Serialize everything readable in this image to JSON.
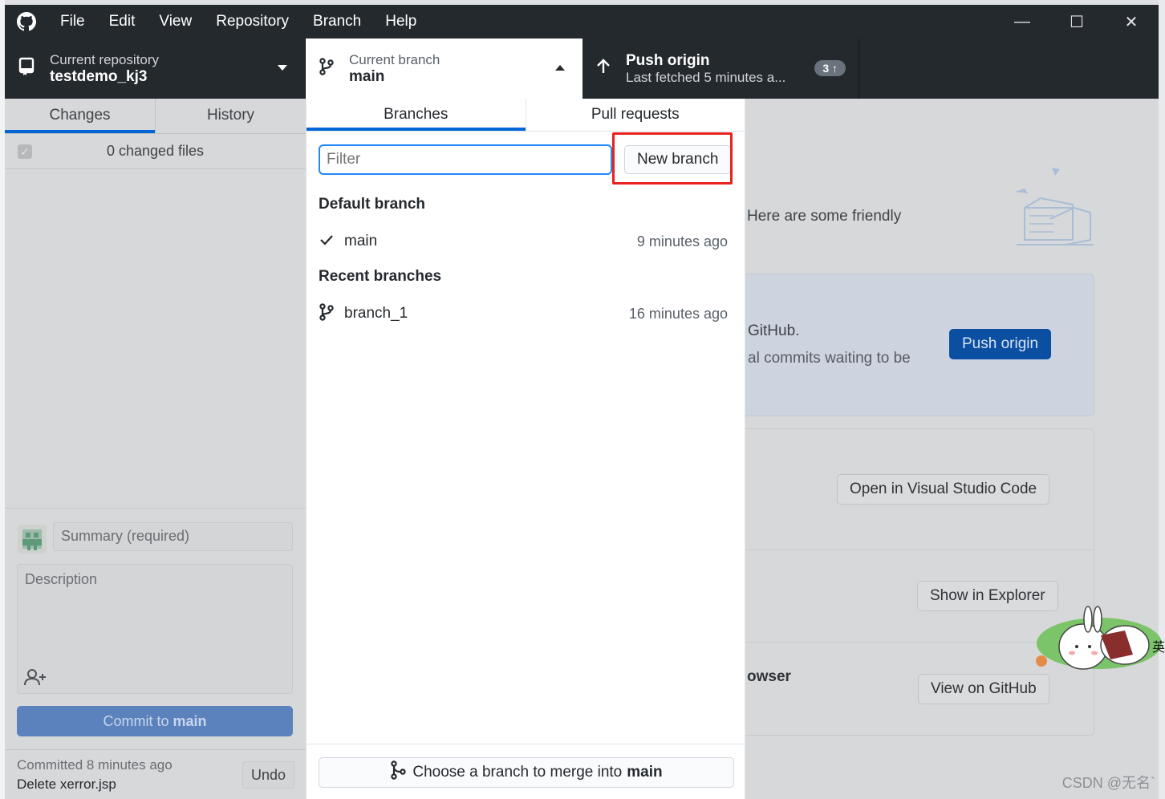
{
  "menu": {
    "items": [
      "File",
      "Edit",
      "View",
      "Repository",
      "Branch",
      "Help"
    ]
  },
  "window_controls": {
    "minimize": "—",
    "maximize": "☐",
    "close": "✕"
  },
  "toolbar": {
    "repo_sub": "Current repository",
    "repo_name": "testdemo_kj3",
    "branch_sub": "Current branch",
    "branch_name": "main",
    "push_title": "Push origin",
    "push_sub": "Last fetched 5 minutes a...",
    "push_badge": "3 ↑"
  },
  "sidebar": {
    "tab_changes": "Changes",
    "tab_history": "History",
    "changed_files": "0 changed files",
    "summary_placeholder": "Summary (required)",
    "description_placeholder": "Description",
    "commit_label": "Commit to",
    "commit_branch": "main",
    "last_commit_time": "Committed 8 minutes ago",
    "last_commit_msg": "Delete xerror.jsp",
    "undo_label": "Undo"
  },
  "dropdown": {
    "tab_branches": "Branches",
    "tab_pull_requests": "Pull requests",
    "filter_placeholder": "Filter",
    "new_branch_label": "New branch",
    "default_heading": "Default branch",
    "default_branches": [
      {
        "name": "main",
        "time": "9 minutes ago"
      }
    ],
    "recent_heading": "Recent branches",
    "recent_branches": [
      {
        "name": "branch_1",
        "time": "16 minutes ago"
      }
    ],
    "merge_label": "Choose a branch to merge into",
    "merge_target": "main"
  },
  "main": {
    "friendly_text": "Here are some friendly",
    "push_card_line1": "GitHub.",
    "push_card_line2": "al commits waiting to be",
    "push_origin_button": "Push origin",
    "open_vscode": "Open in Visual Studio Code",
    "show_explorer": "Show in Explorer",
    "browser_text": "owser",
    "view_github": "View on GitHub"
  },
  "watermark": "CSDN @无名`",
  "colors": {
    "titlebar": "#24292e",
    "accent": "#0366d6",
    "highlight": "#e8221c",
    "push_button": "#0b4fa2"
  },
  "icons": [
    "github-logo-icon",
    "repo-icon",
    "branch-icon",
    "arrow-up-icon",
    "check-icon",
    "merge-icon",
    "add-coauthor-icon"
  ]
}
